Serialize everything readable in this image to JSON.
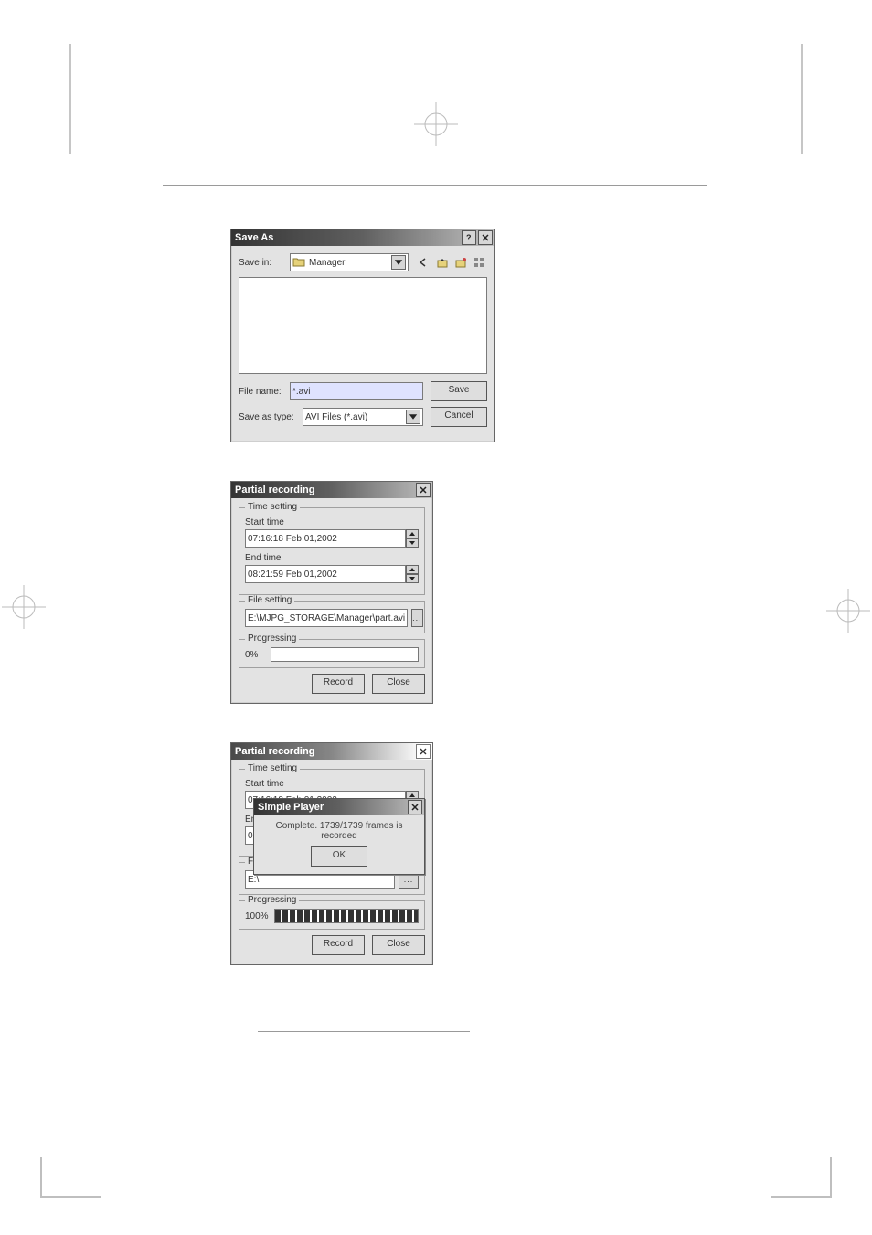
{
  "save_as": {
    "title": "Save As",
    "save_in_label": "Save in:",
    "save_in_folder": "Manager",
    "file_name_label": "File name:",
    "file_name_value": "*.avi",
    "type_label": "Save as type:",
    "type_value": "AVI Files (*.avi)",
    "save_btn": "Save",
    "cancel_btn": "Cancel",
    "tb_icons": {
      "help": "?",
      "close": "×",
      "back": "back-arrow-icon",
      "up": "up-folder-icon",
      "new_folder": "new-folder-icon",
      "views": "views-icon"
    }
  },
  "partial1": {
    "title": "Partial recording",
    "time_legend": "Time setting",
    "start_label": "Start time",
    "start_value": "07:16:18 Feb 01,2002",
    "end_label": "End time",
    "end_value": "08:21:59 Feb 01,2002",
    "file_legend": "File setting",
    "file_value": "E:\\MJPG_STORAGE\\Manager\\part.avi",
    "browse": "...",
    "prog_legend": "Progressing",
    "prog_pct": "0%",
    "record_btn": "Record",
    "close_btn": "Close"
  },
  "partial2": {
    "title": "Partial recording",
    "time_legend": "Time setting",
    "start_label": "Start time",
    "start_value": "07:16:18 Feb 01,2002",
    "end_label": "End time",
    "end_value_prefix": "08:",
    "file_legend": "File setting",
    "file_value_prefix": "E:\\",
    "prog_legend": "Progressing",
    "prog_pct": "100%",
    "record_btn": "Record",
    "close_btn": "Close"
  },
  "msgbox": {
    "title": "Simple Player",
    "text": "Complete. 1739/1739 frames is recorded",
    "ok": "OK"
  }
}
